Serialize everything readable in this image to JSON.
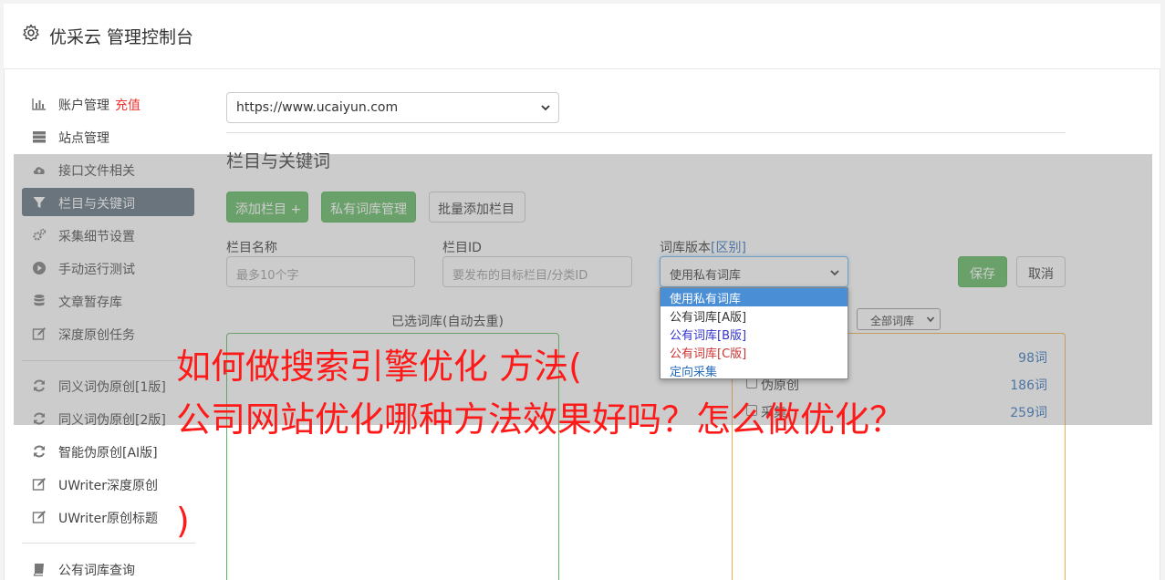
{
  "header": {
    "title": "优采云 管理控制台",
    "icon": "gear-icon"
  },
  "sidebar": {
    "items": [
      {
        "label": "账户管理",
        "tag": "充值",
        "icon": "bar-chart-icon"
      },
      {
        "label": "站点管理",
        "icon": "server-icon"
      },
      {
        "label": "接口文件相关",
        "icon": "cloud-upload-icon"
      },
      {
        "label": "栏目与关键词",
        "icon": "filter-icon",
        "active": true
      },
      {
        "label": "采集细节设置",
        "icon": "gears-icon"
      },
      {
        "label": "手动运行测试",
        "icon": "play-circle-icon"
      },
      {
        "label": "文章暂存库",
        "icon": "database-icon"
      },
      {
        "label": "深度原创任务",
        "icon": "edit-icon"
      },
      {
        "label": "同义词伪原创[1版]",
        "icon": "refresh-icon"
      },
      {
        "label": "同义词伪原创[2版]",
        "icon": "refresh-icon"
      },
      {
        "label": "智能伪原创[AI版]",
        "icon": "refresh-icon"
      },
      {
        "label": "UWriter深度原创",
        "icon": "edit-icon"
      },
      {
        "label": "UWriter原创标题",
        "icon": "edit-icon"
      },
      {
        "label": "公有词库查询",
        "icon": "book-icon"
      }
    ]
  },
  "main": {
    "site_select": "https://www.ucaiyun.com",
    "section_title": "栏目与关键词",
    "buttons": {
      "add_column": "添加栏目 +",
      "private_lib": "私有词库管理",
      "batch_add": "批量添加栏目",
      "save": "保存",
      "cancel": "取消"
    },
    "form": {
      "column_name_label": "栏目名称",
      "column_name_placeholder": "最多10个字",
      "column_id_label": "栏目ID",
      "column_id_placeholder": "要发布的目标栏目/分类ID",
      "lib_version_label": "词库版本",
      "lib_version_link": "[区别]",
      "lib_version_value": "使用私有词库"
    },
    "dropdown_options": [
      {
        "label": "使用私有词库",
        "color": "#ffffff",
        "selected": true
      },
      {
        "label": "公有词库[A版]",
        "color": "#333333"
      },
      {
        "label": "公有词库[B版]",
        "color": "#3333cc"
      },
      {
        "label": "公有词库[C版]",
        "color": "#cc3333"
      },
      {
        "label": "定向采集",
        "color": "#2a6ebd"
      }
    ],
    "selected_caption": "已选词库(自动去重)",
    "filter_select": "全部词库",
    "libraries": [
      {
        "name": "",
        "count": "98词"
      },
      {
        "name": "伪原创",
        "count": "186词"
      },
      {
        "name": "采集",
        "count": "259词"
      }
    ]
  },
  "ad": {
    "line1": "如何做搜索引擎优化 方法(",
    "line2": "公司网站优化哪种方法效果好吗？怎么做优化？",
    "line3": ")"
  },
  "colors": {
    "green": "#5cb85c",
    "accent_blue": "#2a6ebd",
    "ad_red": "#ff1a1a",
    "nav_active": "#5a6d7a"
  }
}
